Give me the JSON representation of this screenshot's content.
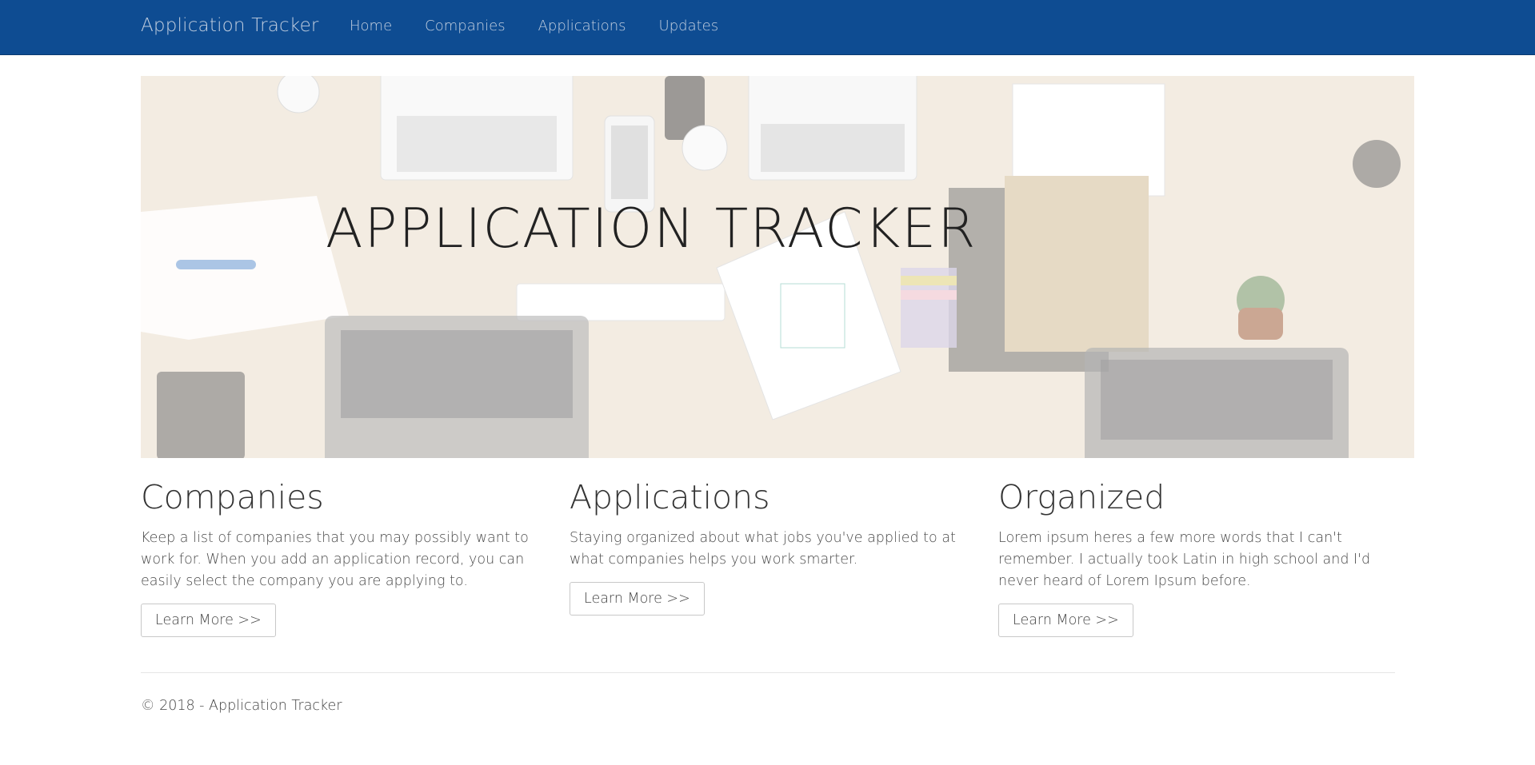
{
  "navbar": {
    "brand": "Application Tracker",
    "links": [
      "Home",
      "Companies",
      "Applications",
      "Updates"
    ],
    "background": "#0e4c92"
  },
  "hero": {
    "title": "APPLICATION TRACKER",
    "image": "office-desk-laptops-photo"
  },
  "features": [
    {
      "heading": "Companies",
      "text": "Keep a list of companies that you may possibly want to work for. When you add an application record, you can easily select the company you are applying to.",
      "button": "Learn More >>"
    },
    {
      "heading": "Applications",
      "text": "Staying organized about what jobs you've applied to at what companies helps you work smarter.",
      "button": "Learn More >>"
    },
    {
      "heading": "Organized",
      "text": "Lorem ipsum heres a few more words that I can't remember. I actually took Latin in high school and I'd never heard of Lorem Ipsum before.",
      "button": "Learn More >>"
    }
  ],
  "footer": {
    "copyright": "© 2018 - Application Tracker"
  }
}
